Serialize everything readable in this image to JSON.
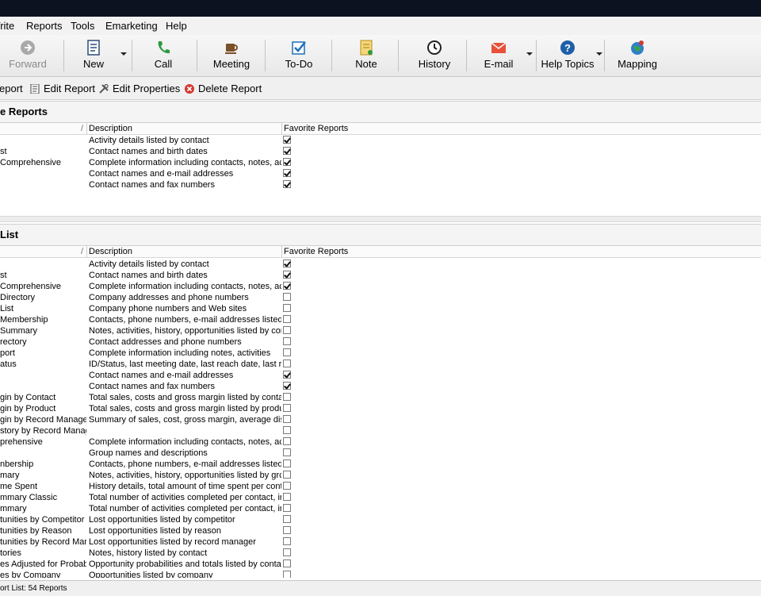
{
  "menu": [
    "Vrite",
    "Reports",
    "Tools",
    "Emarketing",
    "Help"
  ],
  "toolbar": {
    "forward": "Forward",
    "new": "New",
    "call": "Call",
    "meeting": "Meeting",
    "todo": "To-Do",
    "note": "Note",
    "history": "History",
    "email": "E-mail",
    "help_topics": "Help Topics",
    "mapping": "Mapping"
  },
  "actions": {
    "report": "eport",
    "edit_report": "Edit Report",
    "edit_properties": "Edit Properties",
    "delete_report": "Delete Report"
  },
  "favorites": {
    "title": "e Reports",
    "col_desc": "Description",
    "col_fav": "Favorite Reports",
    "rows": [
      {
        "name": "",
        "desc": "Activity details listed by contact",
        "fav": true
      },
      {
        "name": "st",
        "desc": "Contact names and birth dates",
        "fav": true
      },
      {
        "name": "Comprehensive",
        "desc": "Complete information including contacts, notes, act",
        "fav": true
      },
      {
        "name": "",
        "desc": "Contact names and e-mail addresses",
        "fav": true
      },
      {
        "name": "",
        "desc": "Contact names and fax numbers",
        "fav": true
      }
    ]
  },
  "report_list": {
    "title": "List",
    "col_desc": "Description",
    "col_fav": "Favorite Reports",
    "rows": [
      {
        "name": "",
        "desc": "Activity details listed by contact",
        "fav": true
      },
      {
        "name": "st",
        "desc": "Contact names and birth dates",
        "fav": true
      },
      {
        "name": "Comprehensive",
        "desc": "Complete information including contacts, notes, act",
        "fav": true
      },
      {
        "name": "Directory",
        "desc": "Company addresses and phone numbers",
        "fav": false
      },
      {
        "name": "List",
        "desc": "Company phone numbers and Web sites",
        "fav": false
      },
      {
        "name": "Membership",
        "desc": "Contacts, phone numbers, e-mail addresses listed",
        "fav": false
      },
      {
        "name": "Summary",
        "desc": "Notes, activities, history, opportunities listed by cor",
        "fav": false
      },
      {
        "name": "rectory",
        "desc": "Contact addresses and phone numbers",
        "fav": false
      },
      {
        "name": "port",
        "desc": "Complete information including notes, activities",
        "fav": false
      },
      {
        "name": "atus",
        "desc": "ID/Status, last meeting date, last reach date, last re",
        "fav": false
      },
      {
        "name": "",
        "desc": "Contact names and e-mail addresses",
        "fav": true
      },
      {
        "name": "",
        "desc": "Contact names and fax numbers",
        "fav": true
      },
      {
        "name": "gin by Contact",
        "desc": "Total sales, costs and gross margin listed by conta",
        "fav": false
      },
      {
        "name": "gin by Product",
        "desc": "Total sales, costs and gross margin listed by produ",
        "fav": false
      },
      {
        "name": "gin by Record Manager",
        "desc": "Summary of sales, cost, gross margin, average dis",
        "fav": false
      },
      {
        "name": "story by Record Manage",
        "desc": "",
        "fav": false
      },
      {
        "name": "prehensive",
        "desc": "Complete information including contacts, notes, act",
        "fav": false
      },
      {
        "name": "",
        "desc": "Group names and descriptions",
        "fav": false
      },
      {
        "name": "nbership",
        "desc": "Contacts, phone numbers, e-mail addresses listed",
        "fav": false
      },
      {
        "name": "mary",
        "desc": "Notes, activities, history, opportunities listed by grc",
        "fav": false
      },
      {
        "name": "me Spent",
        "desc": "History details, total amount of time spent per conta",
        "fav": false
      },
      {
        "name": "mmary Classic",
        "desc": "Total number of activities completed per contact, ir",
        "fav": false
      },
      {
        "name": "mmary",
        "desc": "Total number of activities completed per contact, ir",
        "fav": false
      },
      {
        "name": "tunities by Competitor",
        "desc": "Lost opportunities listed by competitor",
        "fav": false
      },
      {
        "name": "tunities by Reason",
        "desc": "Lost opportunities listed by reason",
        "fav": false
      },
      {
        "name": "tunities by Record Mar",
        "desc": "Lost opportunities listed by record manager",
        "fav": false
      },
      {
        "name": "tories",
        "desc": "Notes, history listed by contact",
        "fav": false
      },
      {
        "name": "es Adjusted for Probabi",
        "desc": "Opportunity probabilities and totals listed by contac",
        "fav": false
      },
      {
        "name": "es by Company",
        "desc": "Opportunities listed by company",
        "fav": false
      }
    ]
  },
  "status": "ort List: 54 Reports",
  "colors": {
    "accent_green": "#2a9a3c",
    "accent_blue": "#1e6fb8",
    "delete_red": "#d23a32",
    "titlebar": "#0c1220"
  }
}
